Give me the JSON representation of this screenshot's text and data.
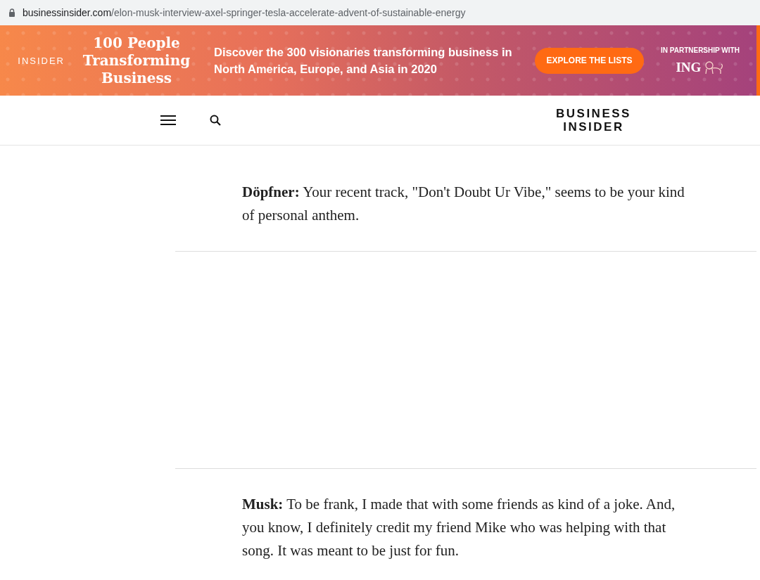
{
  "address_bar": {
    "domain": "businessinsider.com",
    "path": "/elon-musk-interview-axel-springer-tesla-accelerate-advent-of-sustainable-energy"
  },
  "banner": {
    "brand": "INSIDER",
    "title": "100 People Transforming Business",
    "text": "Discover the 300 visionaries transforming business in North America, Europe, and Asia in 2020",
    "button": "EXPLORE THE LISTS",
    "partner_label": "IN PARTNERSHIP WITH",
    "partner": "ING"
  },
  "header": {
    "logo_line_1": "BUSINESS",
    "logo_line_2": "INSIDER"
  },
  "article": [
    {
      "kind": "text",
      "text": "**Döpfner:** Your recent track, \"Don't Doubt Ur Vibe,\" seems to be your kind of personal anthem."
    },
    {
      "kind": "ad"
    },
    {
      "kind": "text",
      "text": "**Musk:** To be frank, I made that with some friends as kind of a joke. And, you know, I definitely credit my friend Mike who was helping with that song. It was meant to be just for fun."
    }
  ]
}
